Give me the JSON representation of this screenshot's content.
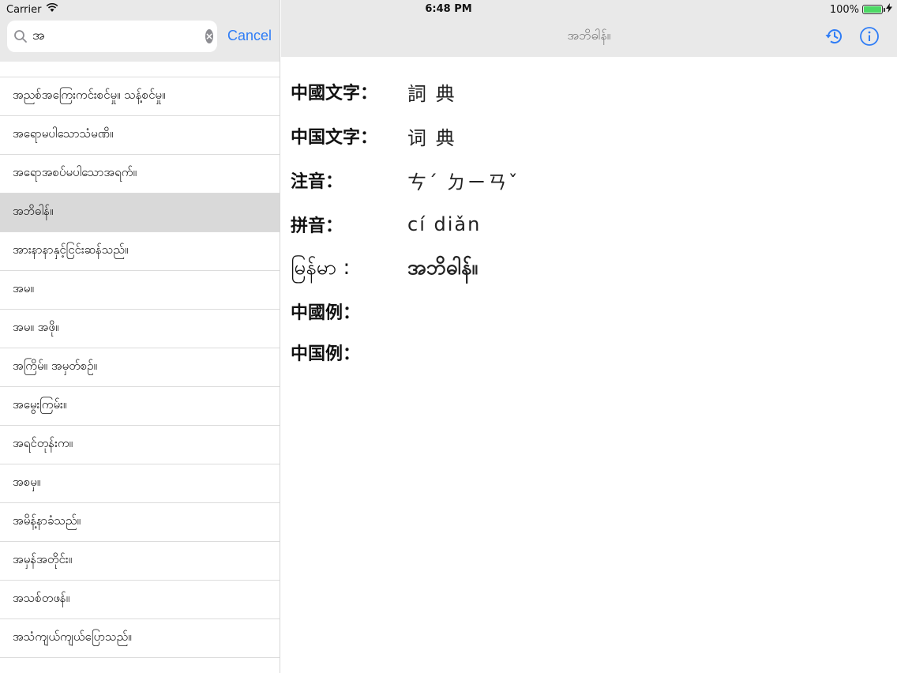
{
  "status": {
    "carrier": "Carrier",
    "time": "6:48 PM",
    "battery": "100%",
    "battery_level": 1.0
  },
  "search": {
    "query": "အ",
    "cancel_label": "Cancel"
  },
  "results": [
    "အညစ်အကြေးကင်းစင်မှု။ သန့်စင်မှု။",
    "အရောမပါသောသံမဏိ။",
    "အရောအစပ်မပါသောအရက်။",
    "အဘိဓါန်။",
    "အားနာနာနှင့်ငြင်းဆန်သည်။",
    "အမ။",
    "အမ။ အဖို။",
    "အကြိမ်။ အမှတ်စဉ်။",
    "အမွေးကြမ်း။",
    "အရင်တုန်းက။",
    "အစမှ။",
    "အမိန့်နာခံသည်။",
    "အမှန်အတိုင်း။",
    "အသစ်တဖန်။",
    "အသံကျယ်ကျယ်ပြောသည်။"
  ],
  "selected_index": 3,
  "detail": {
    "nav_title": "အဘိဓါန်။",
    "entries": [
      {
        "label": "中國文字：",
        "value": "詞 典"
      },
      {
        "label": "中国文字：",
        "value": "词 典"
      },
      {
        "label": "注音：",
        "value": "ㄘˊ ㄉㄧㄢˇ"
      },
      {
        "label": "拼音：",
        "value": "cí diǎn"
      },
      {
        "label": "မြန်မာ :",
        "value": "အဘိဓါန်။"
      },
      {
        "label": "中國例：",
        "value": ""
      },
      {
        "label": "中国例：",
        "value": ""
      }
    ]
  },
  "icons": {
    "search": "search-icon",
    "clear": "clear-icon",
    "history": "history-icon",
    "info": "info-icon",
    "wifi": "wifi-icon",
    "battery": "battery-icon",
    "charging": "charging-bolt-icon"
  },
  "colors": {
    "accent": "#2f7df6",
    "bar_background": "#e9e9e9",
    "selected_row": "#d9d9d9",
    "battery_fill": "#4cd964"
  }
}
